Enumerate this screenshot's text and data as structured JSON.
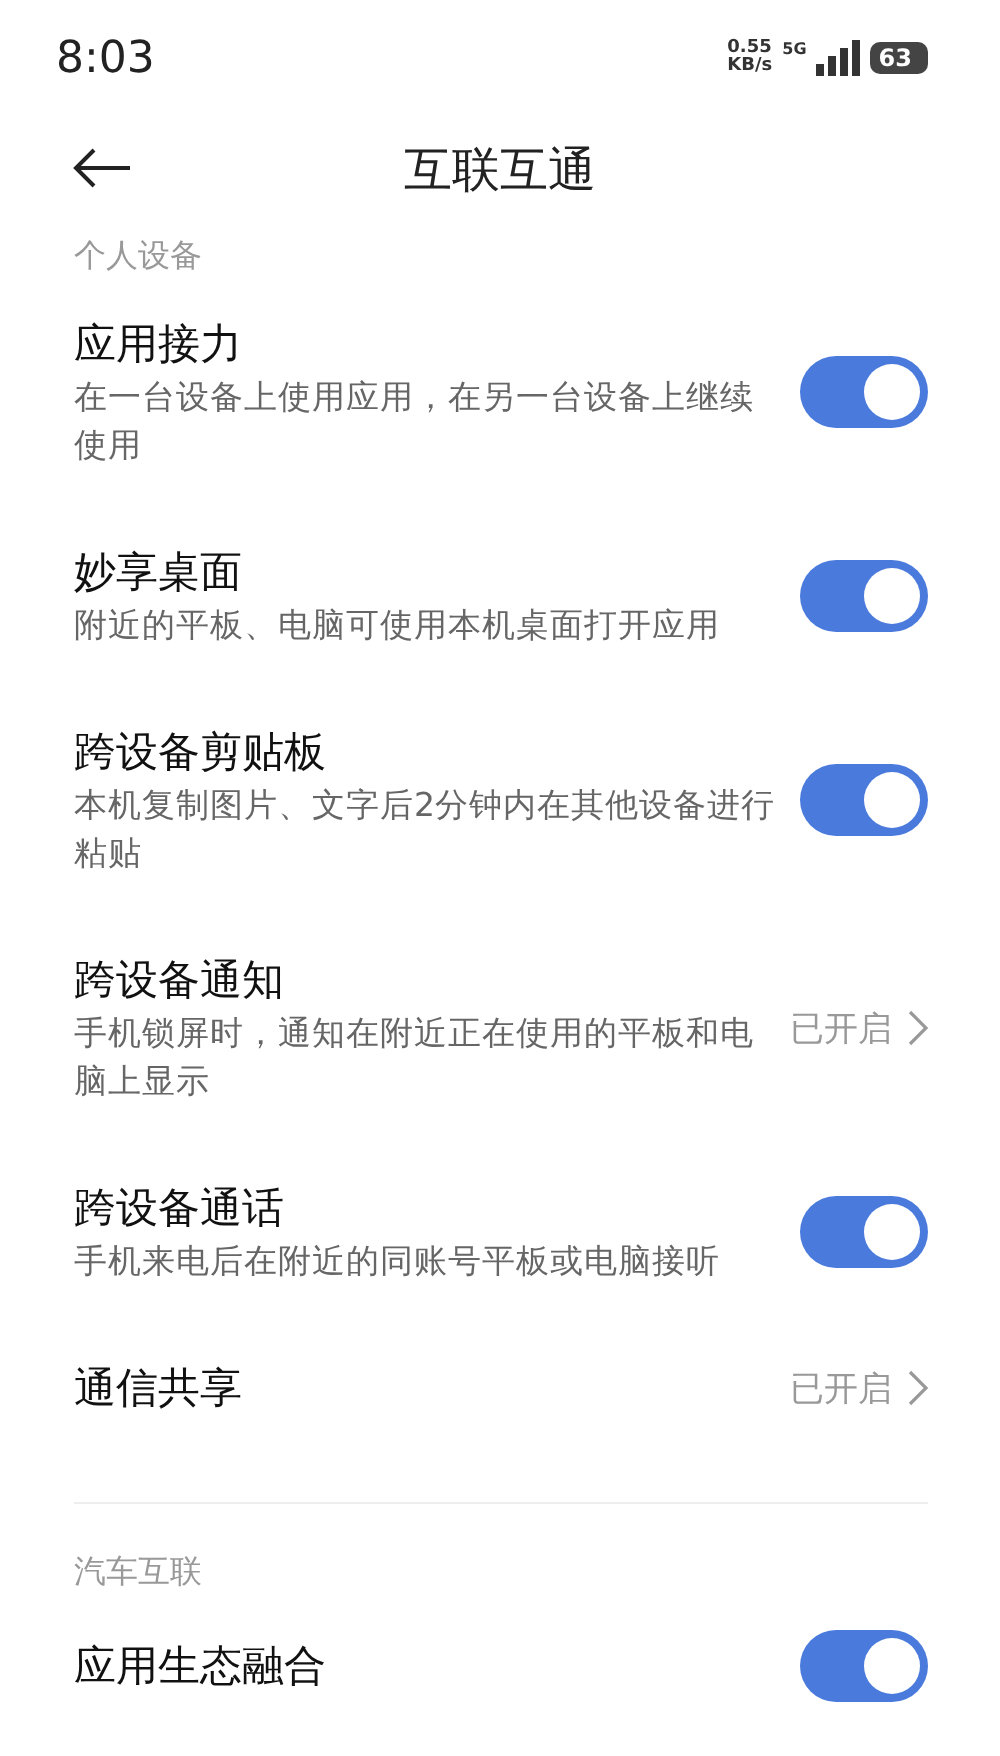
{
  "status_bar": {
    "time": "8:03",
    "speed_value": "0.55",
    "speed_unit": "KB/s",
    "network": "5G",
    "battery": "63"
  },
  "header": {
    "title": "互联互通"
  },
  "sections": [
    {
      "label": "个人设备",
      "items": [
        {
          "kind": "toggle",
          "title": "应用接力",
          "description": "在一台设备上使用应用，在另一台设备上继续使用",
          "on": true
        },
        {
          "kind": "toggle",
          "title": "妙享桌面",
          "description": "附近的平板、电脑可使用本机桌面打开应用",
          "on": true
        },
        {
          "kind": "toggle",
          "title": "跨设备剪贴板",
          "description": "本机复制图片、文字后2分钟内在其他设备进行粘贴",
          "on": true
        },
        {
          "kind": "link",
          "title": "跨设备通知",
          "description": "手机锁屏时，通知在附近正在使用的平板和电脑上显示",
          "value": "已开启"
        },
        {
          "kind": "toggle",
          "title": "跨设备通话",
          "description": "手机来电后在附近的同账号平板或电脑接听",
          "on": true
        },
        {
          "kind": "link",
          "title": "通信共享",
          "value": "已开启"
        }
      ]
    },
    {
      "label": "汽车互联",
      "items": [
        {
          "kind": "toggle",
          "title": "应用生态融合",
          "on": true
        }
      ]
    }
  ]
}
